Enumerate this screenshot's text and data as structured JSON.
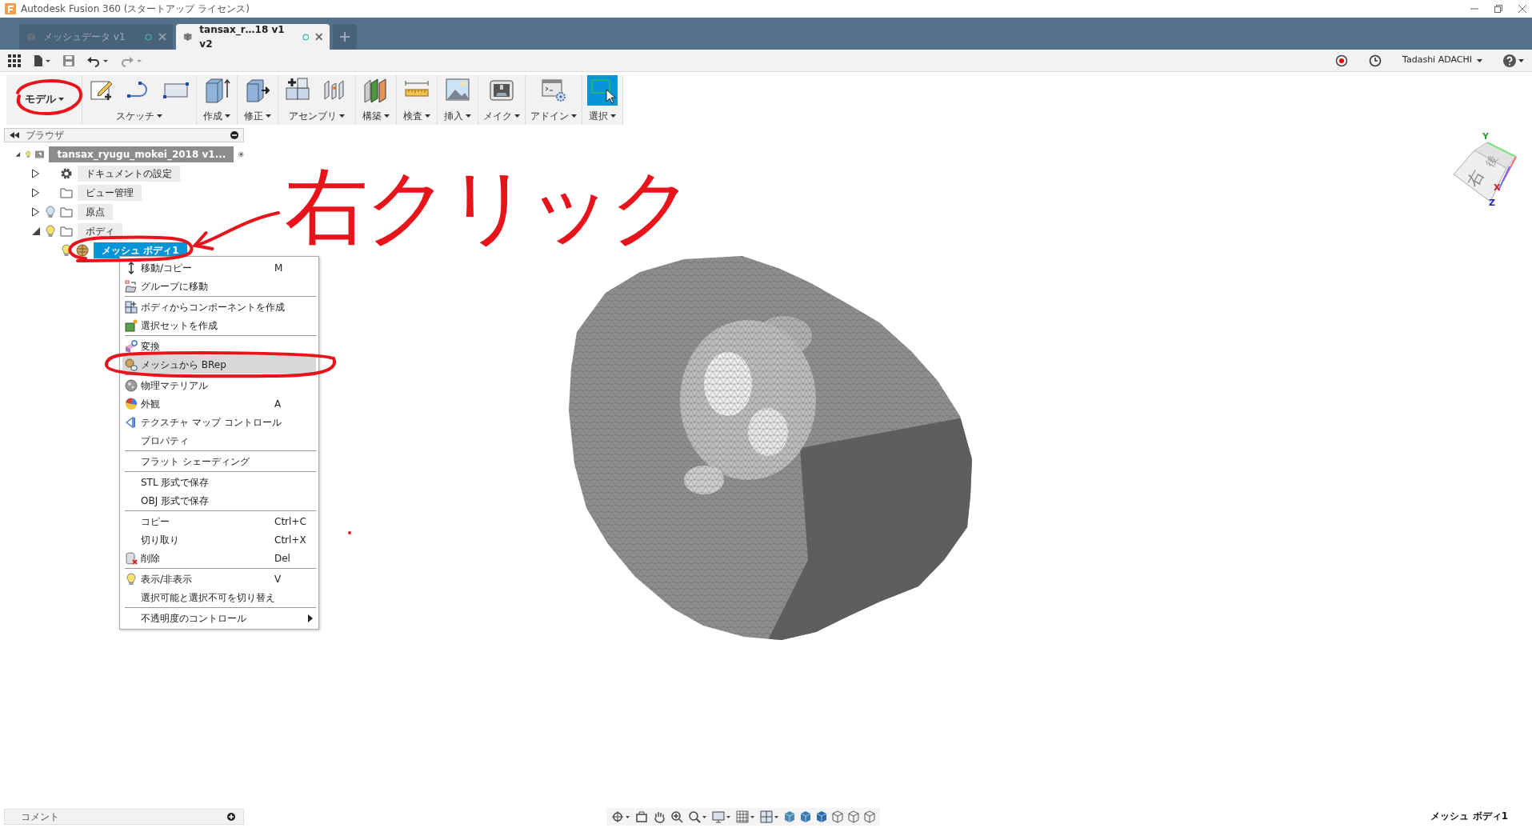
{
  "window": {
    "title": "Autodesk Fusion 360 (スタートアップ ライセンス)"
  },
  "doc_tabs": [
    {
      "label": "メッシュデータ v1",
      "selected": false
    },
    {
      "label": "tansax_r…18 v1 v2",
      "selected": true
    }
  ],
  "account": {
    "user": "Tadashi ADACHI"
  },
  "ribbon": {
    "workspace": "モデル",
    "groups": [
      {
        "label": "スケッチ",
        "active": false
      },
      {
        "label": "作成",
        "active": false
      },
      {
        "label": "修正",
        "active": false
      },
      {
        "label": "アセンブリ",
        "active": false
      },
      {
        "label": "構築",
        "active": false
      },
      {
        "label": "検査",
        "active": false
      },
      {
        "label": "挿入",
        "active": false
      },
      {
        "label": "メイク",
        "active": false
      },
      {
        "label": "アドイン",
        "active": false
      },
      {
        "label": "選択",
        "active": true
      }
    ]
  },
  "browser": {
    "title": "ブラウザ",
    "tree": [
      {
        "label": "tansax_ryugu_mokei_2018 v1...",
        "kind": "component",
        "visible": true,
        "expanded": true,
        "selected": false,
        "children": [
          {
            "label": "ドキュメントの設定",
            "kind": "settings",
            "expanded": false,
            "selected": false
          },
          {
            "label": "ビュー管理",
            "kind": "folder",
            "expanded": false,
            "selected": false
          },
          {
            "label": "原点",
            "kind": "folder",
            "visible": false,
            "expanded": false,
            "selected": false
          },
          {
            "label": "ボディ",
            "kind": "folder",
            "visible": true,
            "expanded": true,
            "selected": false,
            "children": [
              {
                "label": "メッシュ ボディ1",
                "kind": "mesh",
                "visible": true,
                "selected": true
              }
            ]
          }
        ]
      }
    ]
  },
  "context_menu": {
    "items": [
      {
        "label": "移動/コピー",
        "shortcut": "M",
        "selected": false,
        "divider_after": false
      },
      {
        "label": "グループに移動",
        "selected": false,
        "divider_after": true
      },
      {
        "label": "ボディからコンポーネントを作成",
        "selected": false,
        "divider_after": false
      },
      {
        "label": "選択セットを作成",
        "selected": false,
        "divider_after": true
      },
      {
        "label": "変換",
        "selected": false,
        "divider_after": false
      },
      {
        "label": "メッシュから BRep",
        "selected": true,
        "divider_after": true
      },
      {
        "label": "物理マテリアル",
        "selected": false,
        "divider_after": false
      },
      {
        "label": "外観",
        "shortcut": "A",
        "selected": false,
        "divider_after": false
      },
      {
        "label": "テクスチャ マップ コントロール",
        "selected": false,
        "divider_after": false
      },
      {
        "label": "プロパティ",
        "selected": false,
        "divider_after": true
      },
      {
        "label": "フラット シェーディング",
        "selected": false,
        "divider_after": true
      },
      {
        "label": "STL 形式で保存",
        "selected": false,
        "divider_after": false
      },
      {
        "label": "OBJ 形式で保存",
        "selected": false,
        "divider_after": true
      },
      {
        "label": "コピー",
        "shortcut": "Ctrl+C",
        "selected": false,
        "divider_after": false
      },
      {
        "label": "切り取り",
        "shortcut": "Ctrl+X",
        "selected": false,
        "divider_after": false
      },
      {
        "label": "削除",
        "shortcut": "Del",
        "selected": false,
        "divider_after": true
      },
      {
        "label": "表示/非表示",
        "shortcut": "V",
        "selected": false,
        "divider_after": false
      },
      {
        "label": "選択可能と選択不可を切り替え",
        "selected": false,
        "divider_after": true
      },
      {
        "label": "不透明度のコントロール",
        "submenu": true,
        "selected": false,
        "divider_after": false
      }
    ]
  },
  "view_cube": {
    "faces": [
      "右",
      "後"
    ],
    "axes": [
      "Y",
      "X",
      "Z"
    ]
  },
  "annotation": {
    "text": "右クリック"
  },
  "comment_panel": {
    "title": "コメント"
  },
  "status": "メッシュ ボディ1"
}
